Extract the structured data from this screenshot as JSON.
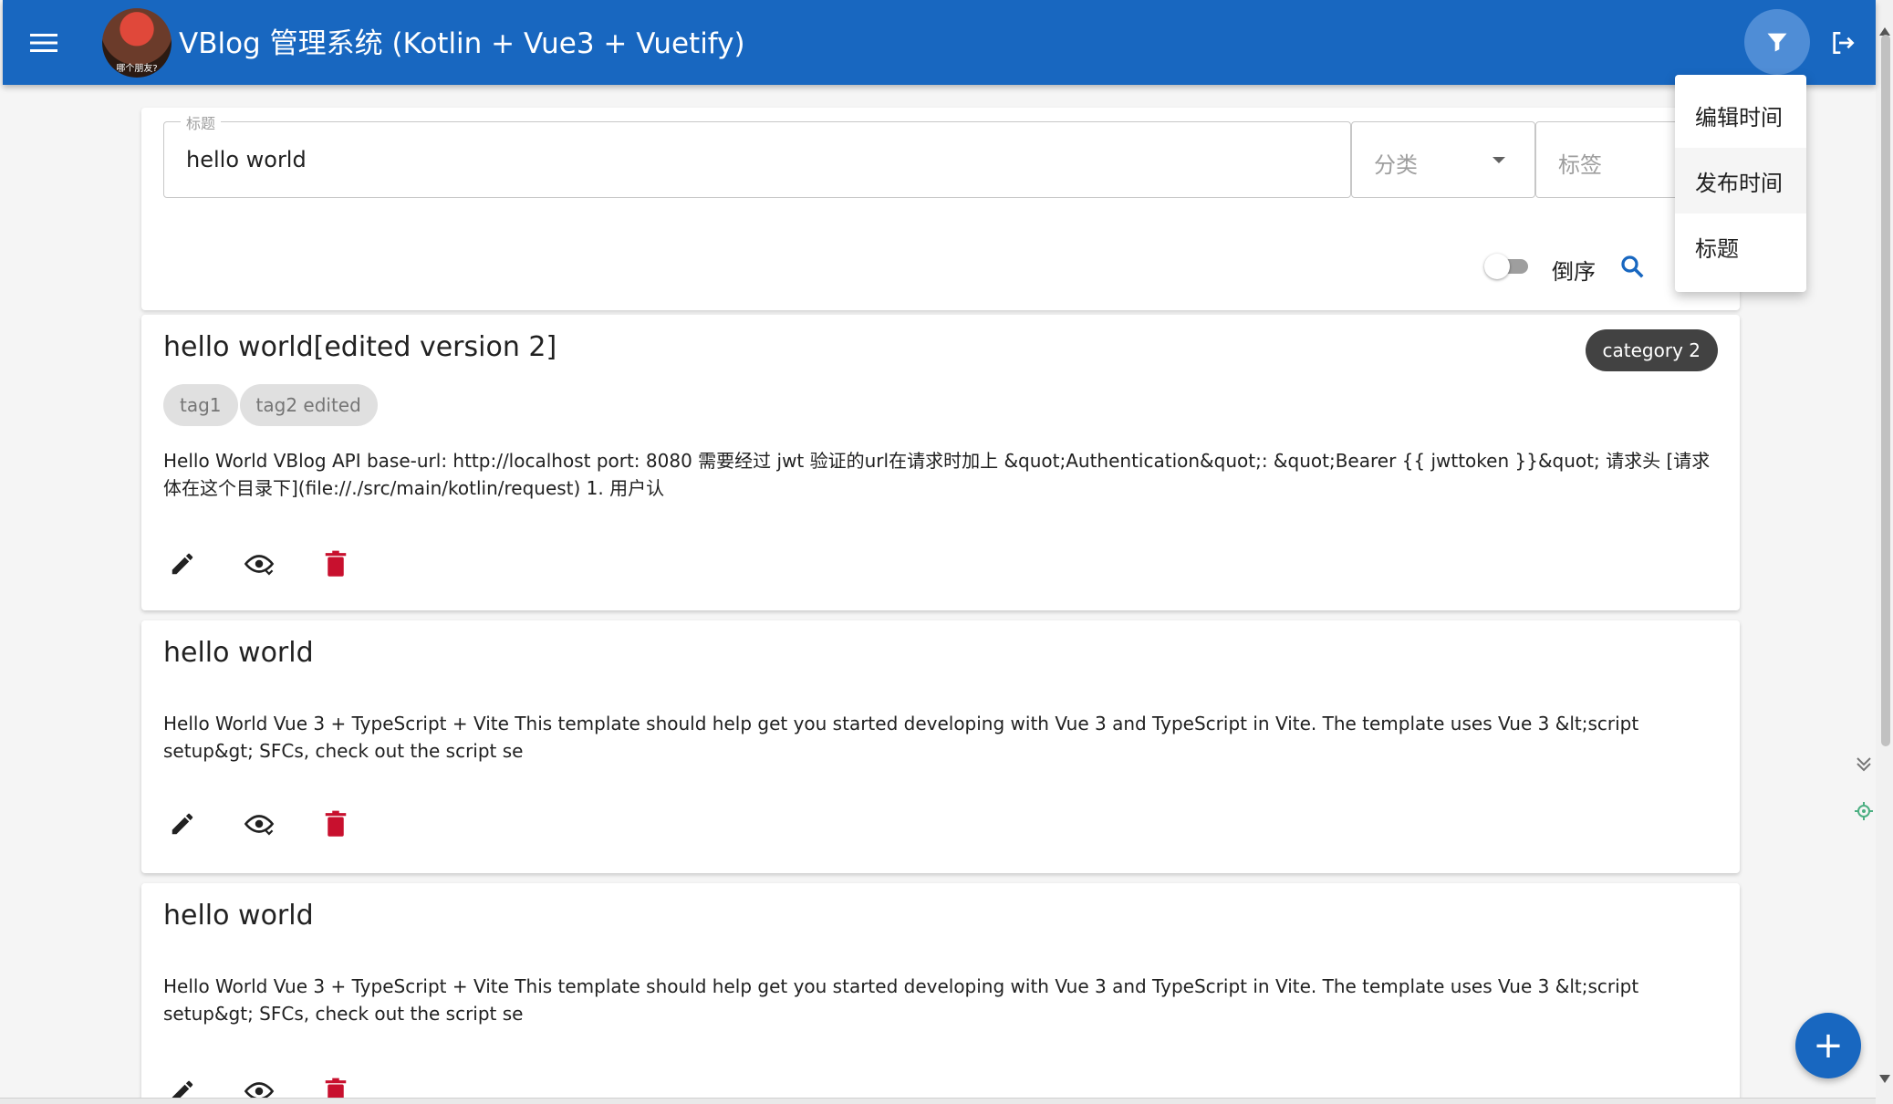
{
  "app": {
    "title": "VBlog 管理系统 (Kotlin + Vue3 + Vuetify)",
    "avatar_text": "哪个朋友?",
    "brand_color": "#1867c0",
    "icons": {
      "nav": "menu-icon",
      "filter": "filter-icon",
      "logout": "logout-icon"
    }
  },
  "search": {
    "title_label": "标题",
    "title_value": "hello world",
    "category_placeholder": "分类",
    "tag_placeholder": "标签",
    "reverse_label": "倒序",
    "reverse_on": false
  },
  "sort_menu": {
    "items": [
      {
        "label": "编辑时间"
      },
      {
        "label": "发布时间"
      },
      {
        "label": "标题"
      }
    ]
  },
  "posts": [
    {
      "title": "hello world[edited version 2]",
      "category": "category 2",
      "tags": [
        "tag1",
        "tag2 edited"
      ],
      "excerpt": "Hello World VBlog API base-url: http://localhost port: 8080 需要经过 jwt 验证的url在请求时加上 &quot;Authentication&quot;: &quot;Bearer {{ jwttoken }}&quot; 请求头 [请求体在这个目录下](file://./src/main/kotlin/request) 1. 用户认"
    },
    {
      "title": "hello world",
      "excerpt": "Hello World Vue 3 + TypeScript + Vite This template should help get you started developing with Vue 3 and TypeScript in Vite. The template uses Vue 3 &lt;script setup&gt; SFCs, check out the script se"
    },
    {
      "title": "hello world",
      "excerpt": "Hello World Vue 3 + TypeScript + Vite This template should help get you started developing with Vue 3 and TypeScript in Vite. The template uses Vue 3 &lt;script setup&gt; SFCs, check out the script se"
    }
  ],
  "fab": {
    "label": "+",
    "icon": "plus-icon"
  }
}
